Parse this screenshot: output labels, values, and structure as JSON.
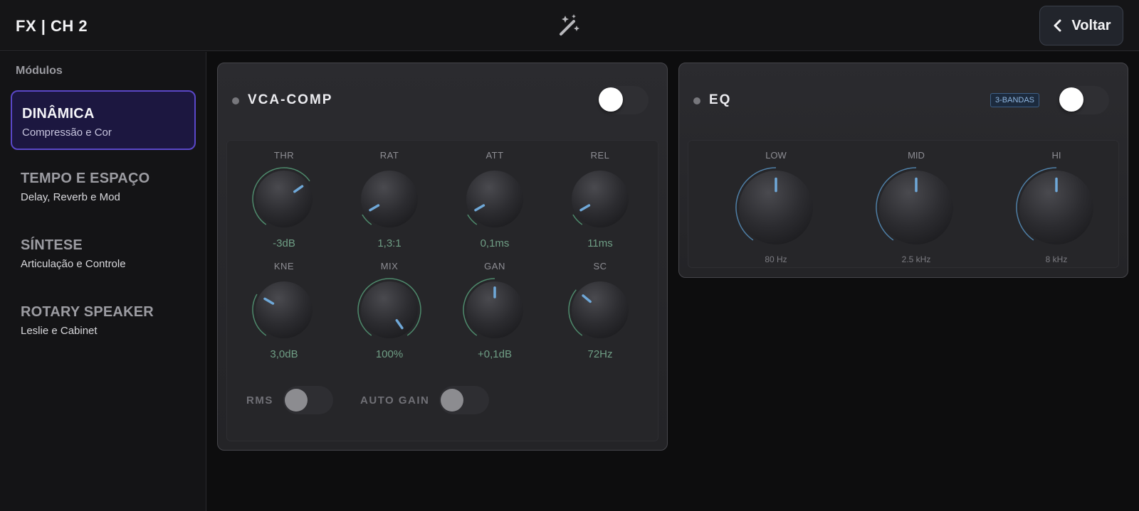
{
  "header": {
    "title": "FX | CH 2",
    "back_label": "Voltar"
  },
  "sidebar": {
    "heading": "Módulos",
    "items": [
      {
        "title": "DINÂMICA",
        "subtitle": "Compressão e Cor",
        "active": true
      },
      {
        "title": "TEMPO E ESPAÇO",
        "subtitle": "Delay, Reverb e Mod",
        "active": false
      },
      {
        "title": "SÍNTESE",
        "subtitle": "Articulação e Controle",
        "active": false
      },
      {
        "title": "ROTARY SPEAKER",
        "subtitle": "Leslie e Cabinet",
        "active": false
      }
    ]
  },
  "comp": {
    "title": "VCA-COMP",
    "enabled": true,
    "knobs": [
      {
        "label": "THR",
        "value": "-3dB"
      },
      {
        "label": "RAT",
        "value": "1,3:1"
      },
      {
        "label": "ATT",
        "value": "0,1ms"
      },
      {
        "label": "REL",
        "value": "11ms"
      },
      {
        "label": "KNE",
        "value": "3,0dB"
      },
      {
        "label": "MIX",
        "value": "100%"
      },
      {
        "label": "GAN",
        "value": "+0,1dB"
      },
      {
        "label": "SC",
        "value": "72Hz"
      }
    ],
    "switches": [
      {
        "label": "RMS",
        "on": false
      },
      {
        "label": "AUTO GAIN",
        "on": false
      }
    ]
  },
  "eq": {
    "title": "EQ",
    "badge": "3-BANDAS",
    "enabled": true,
    "knobs": [
      {
        "label": "LOW",
        "value": "80 Hz"
      },
      {
        "label": "MID",
        "value": "2.5 kHz"
      },
      {
        "label": "HI",
        "value": "8 kHz"
      }
    ]
  },
  "colors": {
    "accent": "#5a47c8",
    "knob_indicator": "#6fa8d8",
    "knob_arc": "#4e8a6c",
    "value_text": "#6f9e85"
  }
}
